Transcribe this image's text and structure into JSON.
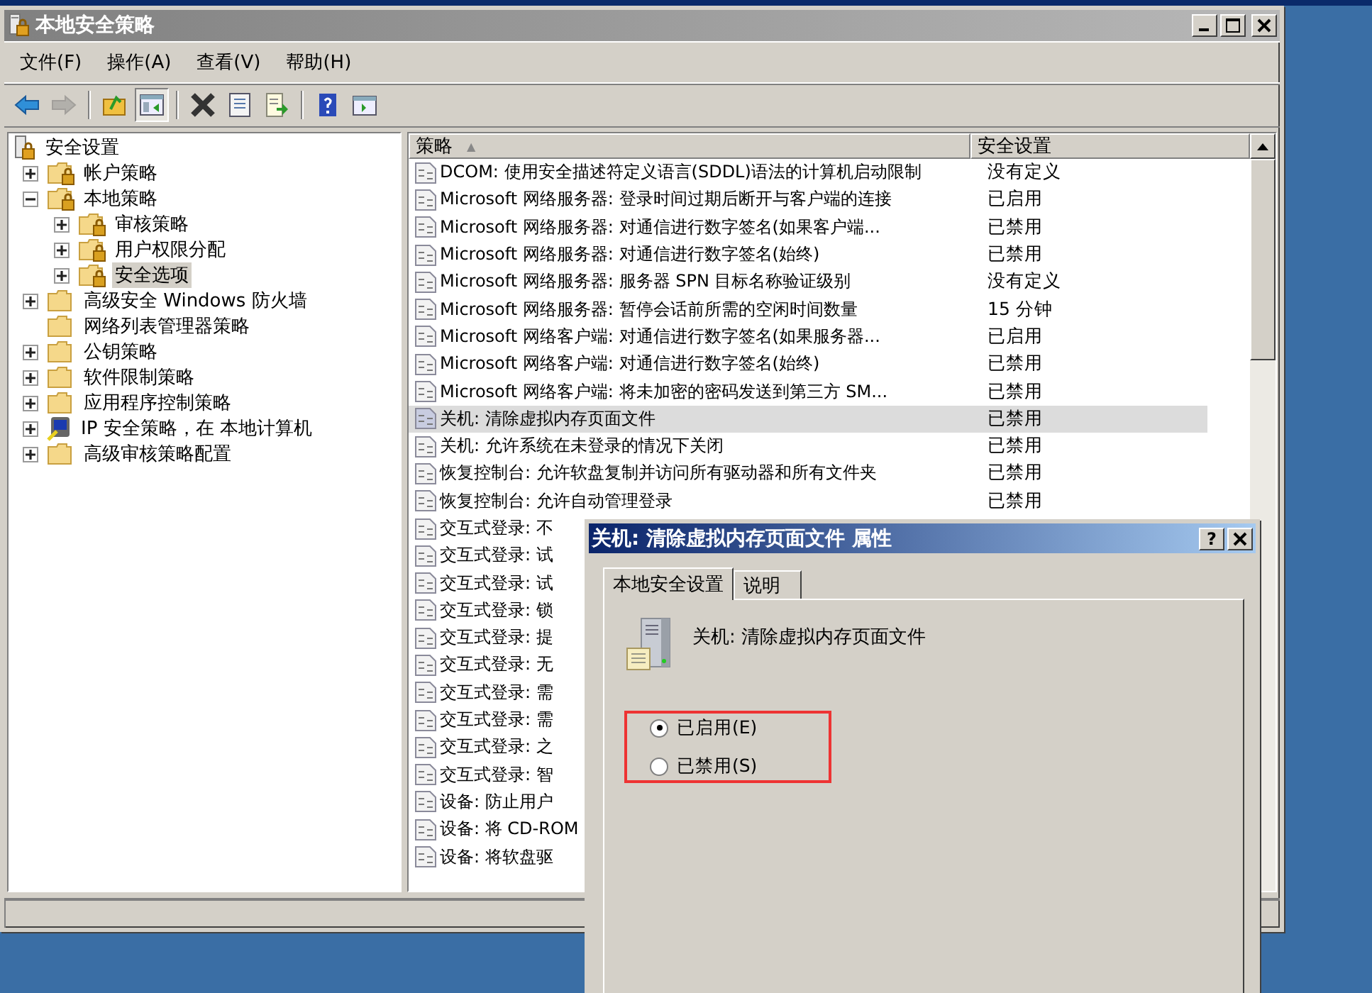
{
  "window": {
    "title": "本地安全策略"
  },
  "menu": [
    {
      "label": "文件(F)"
    },
    {
      "label": "操作(A)"
    },
    {
      "label": "查看(V)"
    },
    {
      "label": "帮助(H)"
    }
  ],
  "toolbar": [
    {
      "kind": "back",
      "disabled": false,
      "pressed": false
    },
    {
      "kind": "forward",
      "disabled": true,
      "pressed": false
    },
    {
      "kind": "separator"
    },
    {
      "kind": "up",
      "disabled": false,
      "pressed": false
    },
    {
      "kind": "tree",
      "disabled": false,
      "pressed": true
    },
    {
      "kind": "separator"
    },
    {
      "kind": "delete",
      "disabled": false,
      "pressed": false
    },
    {
      "kind": "properties",
      "disabled": false,
      "pressed": false
    },
    {
      "kind": "export",
      "disabled": false,
      "pressed": false
    },
    {
      "kind": "separator"
    },
    {
      "kind": "help",
      "disabled": false,
      "pressed": false
    },
    {
      "kind": "console",
      "disabled": false,
      "pressed": false
    }
  ],
  "tree": [
    {
      "label": "安全设置",
      "kind": "root",
      "has_expander": false,
      "selected": false,
      "children": [
        {
          "label": "帐户策略",
          "kind": "lock-folder",
          "has_expander": true,
          "expanded": false,
          "selected": false
        },
        {
          "label": "本地策略",
          "kind": "lock-folder",
          "has_expander": true,
          "expanded": true,
          "selected": false,
          "children": [
            {
              "label": "审核策略",
              "kind": "lock-folder",
              "has_expander": true,
              "expanded": false,
              "selected": false
            },
            {
              "label": "用户权限分配",
              "kind": "lock-folder",
              "has_expander": true,
              "expanded": false,
              "selected": false
            },
            {
              "label": "安全选项",
              "kind": "lock-folder",
              "has_expander": true,
              "expanded": false,
              "selected": true
            }
          ]
        },
        {
          "label": "高级安全 Windows 防火墙",
          "kind": "folder",
          "has_expander": true,
          "expanded": false,
          "selected": false
        },
        {
          "label": "网络列表管理器策略",
          "kind": "folder",
          "has_expander": false,
          "selected": false
        },
        {
          "label": "公钥策略",
          "kind": "folder",
          "has_expander": true,
          "expanded": false,
          "selected": false
        },
        {
          "label": "软件限制策略",
          "kind": "folder",
          "has_expander": true,
          "expanded": false,
          "selected": false
        },
        {
          "label": "应用程序控制策略",
          "kind": "folder",
          "has_expander": true,
          "expanded": false,
          "selected": false
        },
        {
          "label": "IP 安全策略，在 本地计算机",
          "kind": "computer",
          "has_expander": true,
          "expanded": false,
          "selected": false
        },
        {
          "label": "高级审核策略配置",
          "kind": "folder",
          "has_expander": true,
          "expanded": false,
          "selected": false
        }
      ]
    }
  ],
  "table": {
    "columns": [
      {
        "label": "策略",
        "sort": "▲"
      },
      {
        "label": "安全设置"
      }
    ],
    "rows": [
      {
        "policy": "DCOM: 使用安全描述符定义语言(SDDL)语法的计算机启动限制",
        "setting": "没有定义",
        "selected": false
      },
      {
        "policy": "Microsoft 网络服务器: 登录时间过期后断开与客户端的连接",
        "setting": "已启用",
        "selected": false
      },
      {
        "policy": "Microsoft 网络服务器: 对通信进行数字签名(如果客户端...",
        "setting": "已禁用",
        "selected": false
      },
      {
        "policy": "Microsoft 网络服务器: 对通信进行数字签名(始终)",
        "setting": "已禁用",
        "selected": false
      },
      {
        "policy": "Microsoft 网络服务器: 服务器 SPN 目标名称验证级别",
        "setting": "没有定义",
        "selected": false
      },
      {
        "policy": "Microsoft 网络服务器: 暂停会话前所需的空闲时间数量",
        "setting": "15 分钟",
        "selected": false
      },
      {
        "policy": "Microsoft 网络客户端: 对通信进行数字签名(如果服务器...",
        "setting": "已启用",
        "selected": false
      },
      {
        "policy": "Microsoft 网络客户端: 对通信进行数字签名(始终)",
        "setting": "已禁用",
        "selected": false
      },
      {
        "policy": "Microsoft 网络客户端: 将未加密的密码发送到第三方 SM...",
        "setting": "已禁用",
        "selected": false
      },
      {
        "policy": "关机: 清除虚拟内存页面文件",
        "setting": "已禁用",
        "selected": true
      },
      {
        "policy": "关机: 允许系统在未登录的情况下关闭",
        "setting": "已禁用",
        "selected": false
      },
      {
        "policy": "恢复控制台: 允许软盘复制并访问所有驱动器和所有文件夹",
        "setting": "已禁用",
        "selected": false
      },
      {
        "policy": "恢复控制台: 允许自动管理登录",
        "setting": "已禁用",
        "selected": false
      },
      {
        "policy": "交互式登录: 不",
        "selected": false
      },
      {
        "policy": "交互式登录: 试",
        "selected": false
      },
      {
        "policy": "交互式登录: 试",
        "selected": false
      },
      {
        "policy": "交互式登录: 锁",
        "selected": false
      },
      {
        "policy": "交互式登录: 提",
        "selected": false
      },
      {
        "policy": "交互式登录: 无",
        "selected": false
      },
      {
        "policy": "交互式登录: 需",
        "selected": false
      },
      {
        "policy": "交互式登录: 需",
        "selected": false
      },
      {
        "policy": "交互式登录: 之",
        "selected": false
      },
      {
        "policy": "交互式登录: 智",
        "selected": false
      },
      {
        "policy": "设备: 防止用户",
        "selected": false
      },
      {
        "policy": "设备: 将 CD-ROM",
        "selected": false
      },
      {
        "policy": "设备: 将软盘驱",
        "selected": false
      }
    ]
  },
  "dialog": {
    "title": "关机: 清除虚拟内存页面文件 属性",
    "help_button": "?",
    "tabs": [
      {
        "label": "本地安全设置",
        "selected": true
      },
      {
        "label": "说明",
        "selected": false
      }
    ],
    "policy_name": "关机: 清除虚拟内存页面文件",
    "options": [
      {
        "label": "已启用(E)",
        "selected": true
      },
      {
        "label": "已禁用(S)",
        "selected": false
      }
    ]
  }
}
